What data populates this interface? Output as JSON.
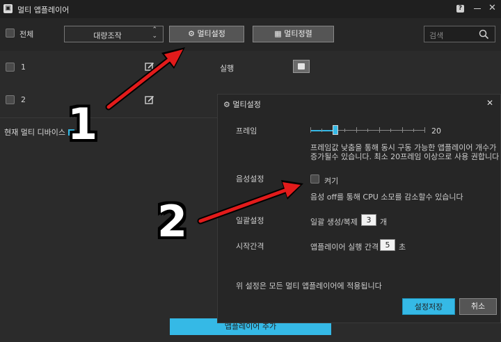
{
  "window": {
    "title": "멀티 앱플레이어",
    "help_glyph": "?",
    "close_glyph": "✕"
  },
  "toolbar": {
    "select_all_label": "전체",
    "bulk_action_label": "대량조작",
    "multi_settings_label": "멀티설정",
    "multi_arrange_label": "멀티정렬",
    "search_placeholder": "검색"
  },
  "instances": [
    {
      "name": "1",
      "run_label": "실행"
    },
    {
      "name": "2"
    }
  ],
  "current_devices_label": "현재 멀티 디바이스",
  "add_player_label": "앱플레이어 추가",
  "dialog": {
    "title": "멀티설정",
    "close_glyph": "✕",
    "frame_label": "프레임",
    "frame_value": "20",
    "frame_level_fraction": 0.22,
    "frame_note_line1": "프레임값 낮춤을 통해 동시 구동 가능한 앱플레이어 개수가",
    "frame_note_line2": "증가될수 있습니다. 최소 20프레임 이상으로 사용 권합니다",
    "audio_label": "음성설정",
    "audio_checkbox_label": "켜기",
    "audio_note": "음성 off를 통해 CPU 소모를 감소할수 있습니다",
    "batch_label": "일괄설정",
    "batch_text": "일괄 생성/복제",
    "batch_value": "3",
    "batch_unit": "개",
    "interval_label": "시작간격",
    "interval_text": "앱플레이어 실행 간격",
    "interval_value": "5",
    "interval_unit": "초",
    "footer_note": "위 설정은 모든 멀티 앱플레이어에 적용됩니다",
    "save_label": "설정저장",
    "cancel_label": "취소"
  },
  "annotations": {
    "step1": "1",
    "step2": "2"
  },
  "colors": {
    "accent": "#35b9e6",
    "arrow": "#e21b1b",
    "background": "#2b2b2b"
  }
}
